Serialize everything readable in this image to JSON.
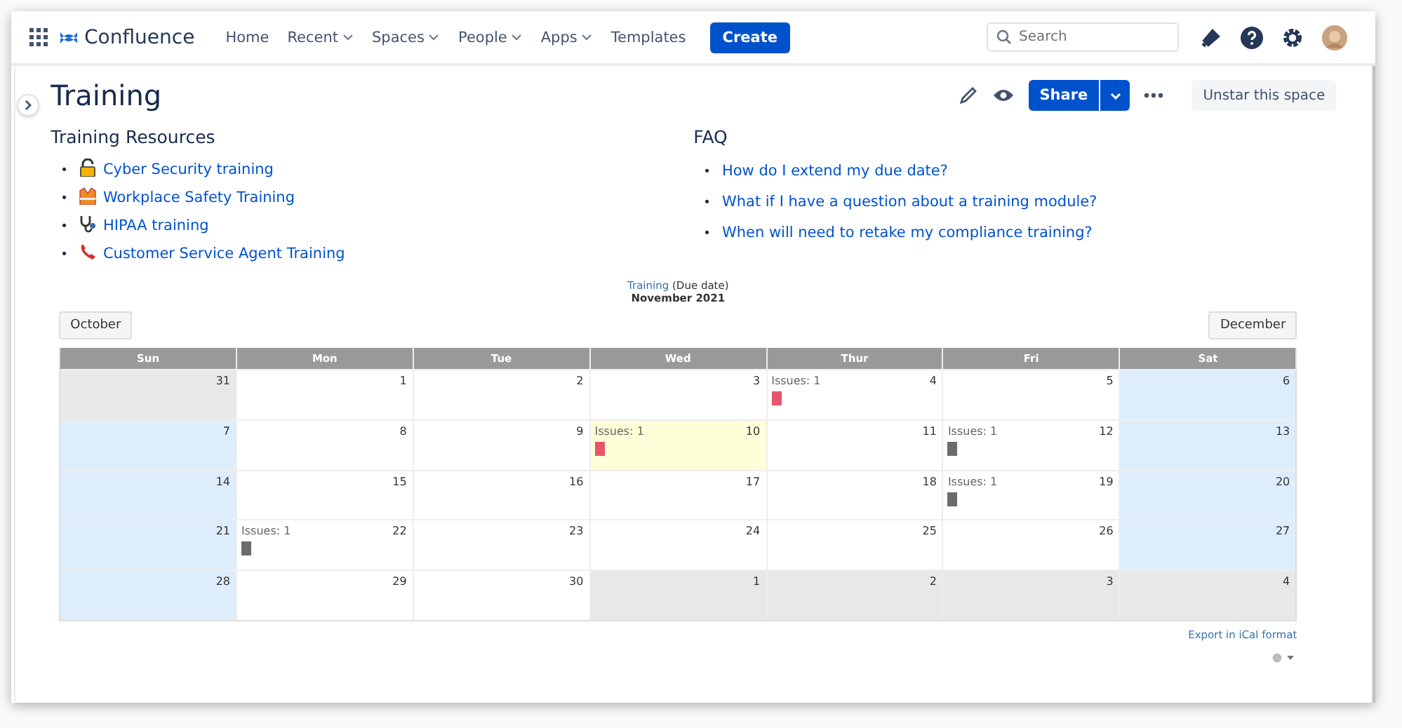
{
  "nav": {
    "product": "Confluence",
    "items": [
      {
        "label": "Home",
        "dropdown": false
      },
      {
        "label": "Recent",
        "dropdown": true
      },
      {
        "label": "Spaces",
        "dropdown": true
      },
      {
        "label": "People",
        "dropdown": true
      },
      {
        "label": "Apps",
        "dropdown": true
      },
      {
        "label": "Templates",
        "dropdown": false
      }
    ],
    "create": "Create",
    "search": {
      "placeholder": "Search"
    }
  },
  "page": {
    "title": "Training",
    "share": "Share",
    "unstar": "Unstar this space"
  },
  "resources": {
    "heading": "Training Resources",
    "items": [
      {
        "bullet": "•",
        "label": "Cyber Security training",
        "kind": "lock"
      },
      {
        "bullet": "•",
        "label": "Workplace Safety Training",
        "kind": "vest"
      },
      {
        "bullet": "•",
        "label": "HIPAA training",
        "kind": "stethoscope"
      },
      {
        "bullet": "•",
        "label": "Customer Service Agent Training",
        "kind": "phone"
      }
    ]
  },
  "faq": {
    "heading": "FAQ",
    "items": [
      {
        "bullet": "•",
        "label": "How do I extend my due date?"
      },
      {
        "bullet": "•",
        "label": "What if I have a question about a training module?"
      },
      {
        "bullet": "•",
        "label": "When will need to retake my compliance training?"
      }
    ]
  },
  "calendar": {
    "source": "Training",
    "source_note": "(Due date)",
    "month": "November 2021",
    "prev": "October",
    "next": "December",
    "weekdays": [
      "Sun",
      "Mon",
      "Tue",
      "Wed",
      "Thur",
      "Fri",
      "Sat"
    ],
    "weeks": [
      [
        {
          "day": "31",
          "kind": "other"
        },
        {
          "day": "1",
          "kind": "normal"
        },
        {
          "day": "2",
          "kind": "normal"
        },
        {
          "day": "3",
          "kind": "normal"
        },
        {
          "day": "4",
          "kind": "normal",
          "event": {
            "label": "Issues: 1",
            "color": "#e8546b"
          }
        },
        {
          "day": "5",
          "kind": "normal"
        },
        {
          "day": "6",
          "kind": "weekend"
        }
      ],
      [
        {
          "day": "7",
          "kind": "weekend"
        },
        {
          "day": "8",
          "kind": "normal"
        },
        {
          "day": "9",
          "kind": "normal"
        },
        {
          "day": "10",
          "kind": "today",
          "event": {
            "label": "Issues: 1",
            "color": "#e8546b"
          }
        },
        {
          "day": "11",
          "kind": "normal"
        },
        {
          "day": "12",
          "kind": "normal",
          "event": {
            "label": "Issues: 1",
            "color": "#6b6b6b"
          }
        },
        {
          "day": "13",
          "kind": "weekend"
        }
      ],
      [
        {
          "day": "14",
          "kind": "weekend"
        },
        {
          "day": "15",
          "kind": "normal"
        },
        {
          "day": "16",
          "kind": "normal"
        },
        {
          "day": "17",
          "kind": "normal"
        },
        {
          "day": "18",
          "kind": "normal"
        },
        {
          "day": "19",
          "kind": "normal",
          "event": {
            "label": "Issues: 1",
            "color": "#6b6b6b"
          }
        },
        {
          "day": "20",
          "kind": "weekend"
        }
      ],
      [
        {
          "day": "21",
          "kind": "weekend"
        },
        {
          "day": "22",
          "kind": "normal",
          "event": {
            "label": "Issues: 1",
            "color": "#6b6b6b"
          }
        },
        {
          "day": "23",
          "kind": "normal"
        },
        {
          "day": "24",
          "kind": "normal"
        },
        {
          "day": "25",
          "kind": "normal"
        },
        {
          "day": "26",
          "kind": "normal"
        },
        {
          "day": "27",
          "kind": "weekend"
        }
      ],
      [
        {
          "day": "28",
          "kind": "weekend"
        },
        {
          "day": "29",
          "kind": "normal"
        },
        {
          "day": "30",
          "kind": "normal"
        },
        {
          "day": "1",
          "kind": "other"
        },
        {
          "day": "2",
          "kind": "other"
        },
        {
          "day": "3",
          "kind": "other"
        },
        {
          "day": "4",
          "kind": "other"
        }
      ]
    ],
    "export": "Export in iCal format"
  }
}
